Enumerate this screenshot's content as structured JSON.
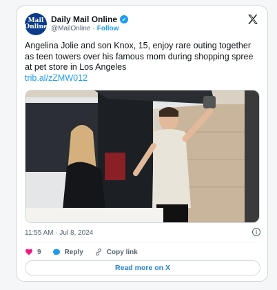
{
  "tweet": {
    "author": {
      "avatar_text": [
        "Mail",
        "Online"
      ],
      "display_name": "Daily Mail Online",
      "handle": "@MailOnline",
      "separator": "·",
      "follow_label": "Follow",
      "verified_mark": "✓"
    },
    "text": "Angelina Jolie and son Knox, 15, enjoy rare outing together as teen towers over his famous mom during shopping spree at pet store in Los Angeles",
    "link": "trib.al/zZMW012",
    "timestamp": "11:55 AM · Jul 8, 2024",
    "info_icon_glyph": "i",
    "actions": {
      "like_count": "9",
      "reply_label": "Reply",
      "copy_link_label": "Copy link"
    },
    "read_more_label": "Read more on X",
    "media": {
      "description_icon": "photo"
    }
  },
  "colors": {
    "accent": "#1d9bf0",
    "like": "#f91880",
    "text": "#0f1419",
    "muted": "#536471",
    "border": "#cfd9de"
  }
}
